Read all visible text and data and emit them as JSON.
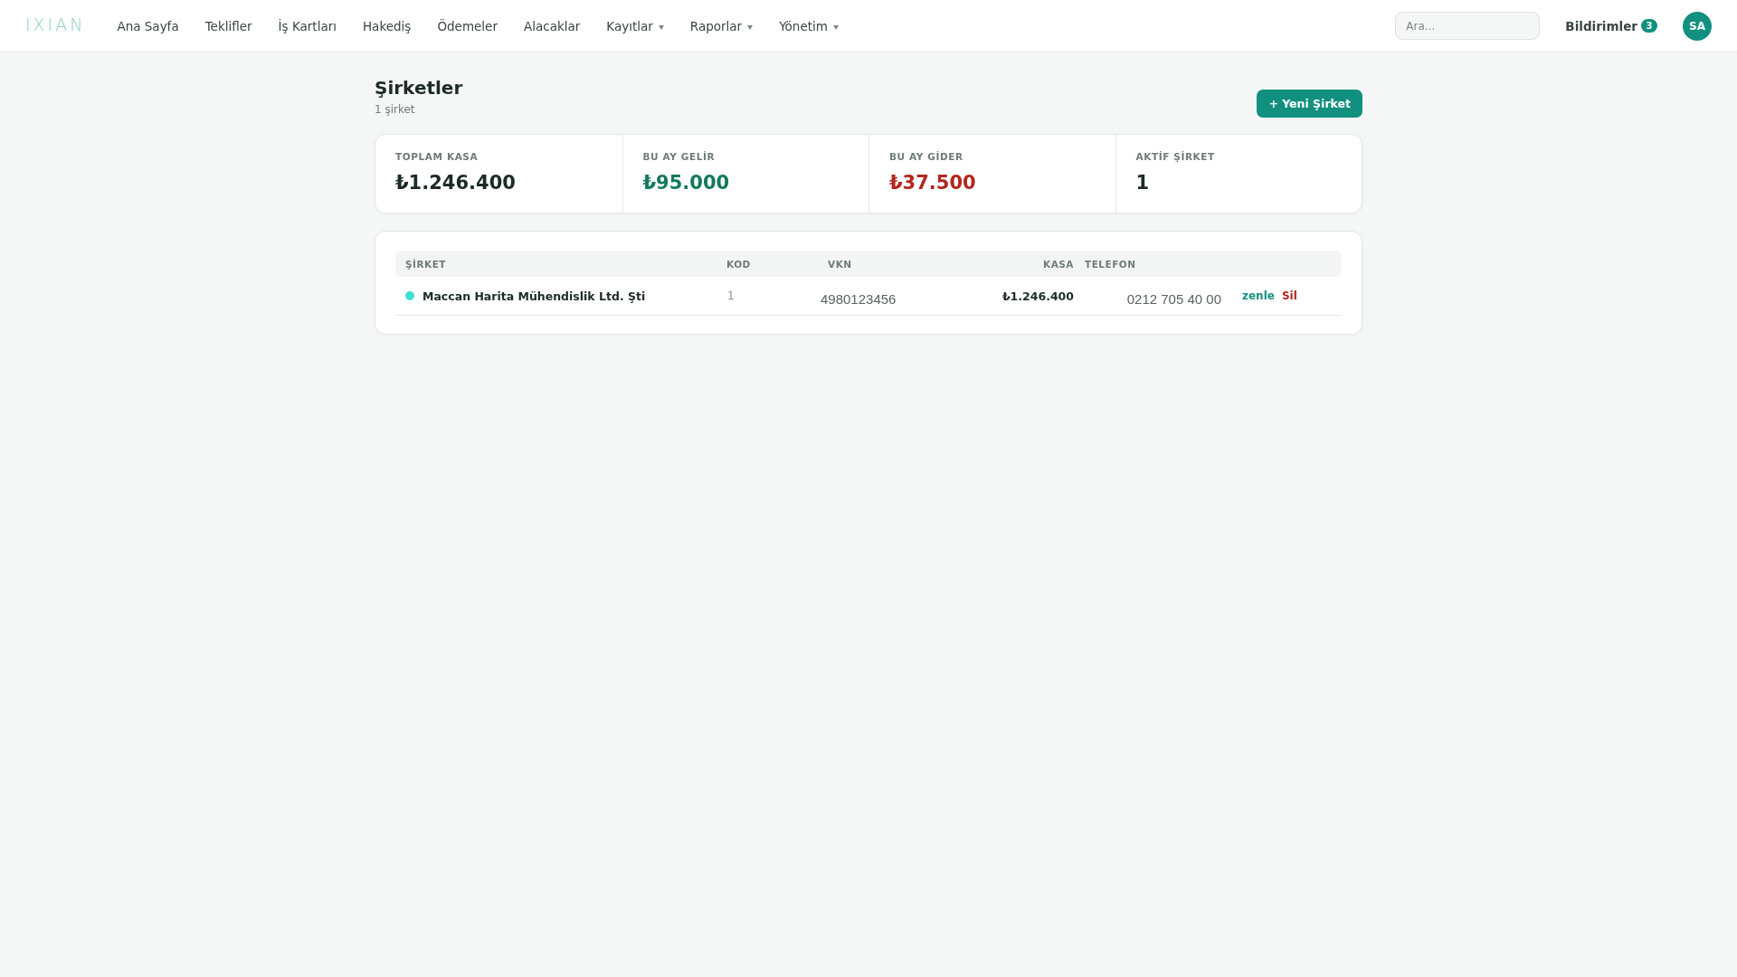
{
  "nav": {
    "logo": "IXIAN",
    "items": [
      {
        "label": "Ana Sayfa",
        "dropdown": false
      },
      {
        "label": "Teklifler",
        "dropdown": false
      },
      {
        "label": "İş Kartları",
        "dropdown": false
      },
      {
        "label": "Hakediş",
        "dropdown": false
      },
      {
        "label": "Ödemeler",
        "dropdown": false
      },
      {
        "label": "Alacaklar",
        "dropdown": false
      },
      {
        "label": "Kayıtlar",
        "dropdown": true
      },
      {
        "label": "Raporlar",
        "dropdown": true
      },
      {
        "label": "Yönetim",
        "dropdown": true
      }
    ],
    "search": {
      "placeholder": "Ara..."
    },
    "notifications": {
      "label": "Bildirimler",
      "count": "3"
    },
    "avatar": "SA"
  },
  "page": {
    "title": "Şirketler",
    "subtitle": "1 şirket",
    "new_button": "+ Yeni Şirket"
  },
  "stats": [
    {
      "label": "TOPLAM KASA",
      "value": "₺1.246.400",
      "color": "#1d2b27"
    },
    {
      "label": "BU AY GELİR",
      "value": "₺95.000",
      "color": "#127a5c"
    },
    {
      "label": "BU AY GİDER",
      "value": "₺37.500",
      "color": "#b3261e"
    },
    {
      "label": "AKTİF ŞİRKET",
      "value": "1",
      "color": "#1d2b27"
    }
  ],
  "table": {
    "columns": [
      "ŞİRKET",
      "KOD",
      "VKN",
      "KASA",
      "TELEFON"
    ],
    "rows": [
      {
        "color": "#3ee0d3",
        "cells": [
          "Maccan Harita Mühendislik Ltd. Şti",
          "1",
          "4980123456",
          "₺1.246.400",
          "0212 705 40 00"
        ],
        "actions": [
          {
            "label": "zenle",
            "kind": "edit"
          },
          {
            "label": "Sil",
            "kind": "delete"
          }
        ]
      }
    ]
  }
}
